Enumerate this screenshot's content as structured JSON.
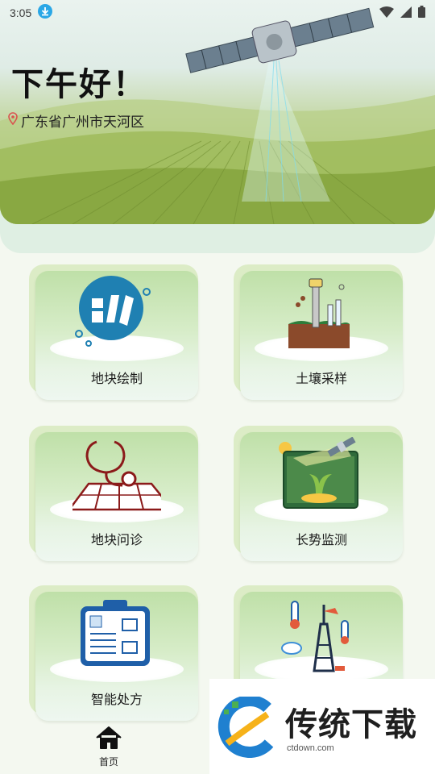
{
  "status_bar": {
    "time": "3:05"
  },
  "header": {
    "greeting": "下午好！",
    "location": "广东省广州市天河区"
  },
  "features": [
    {
      "label": "地块绘制",
      "icon": "field-drawing-icon"
    },
    {
      "label": "土壤采样",
      "icon": "soil-sampling-icon"
    },
    {
      "label": "地块问诊",
      "icon": "field-diagnosis-icon"
    },
    {
      "label": "长势监测",
      "icon": "growth-monitoring-icon"
    },
    {
      "label": "智能处方",
      "icon": "smart-prescription-icon"
    },
    {
      "label": "",
      "icon": "weather-station-icon"
    }
  ],
  "bottom_nav": {
    "home_label": "首页"
  },
  "watermark": {
    "title": "传统下载",
    "domain": "ctdown.com"
  },
  "colors": {
    "card_green": "#bfe0a8",
    "accent_blue": "#1f7fb0",
    "soil_brown": "#8b4a2b"
  }
}
